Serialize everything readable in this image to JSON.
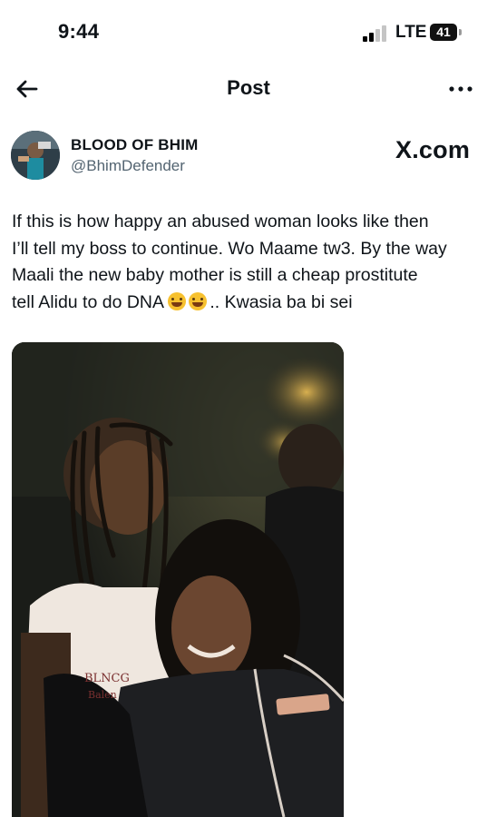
{
  "status_bar": {
    "time": "9:44",
    "network": "LTE",
    "battery": "41"
  },
  "nav": {
    "title": "Post",
    "back_icon": "arrow-left-icon",
    "more_icon": "more-horizontal-icon"
  },
  "author": {
    "name": "BLOOD OF BHIM",
    "handle": "@BhimDefender"
  },
  "source_logo": "X.com",
  "post": {
    "lines": [
      "If this is how happy an abused woman looks like then",
      "I’ll tell my boss to continue. Wo Maame tw3. By the way",
      "Maali the new baby mother is still a cheap prostitute",
      "tell Alidu to do DNA"
    ],
    "line4_suffix": ".. Kwasia ba bi sei",
    "emojis": [
      "rolling-on-floor-laughing-emoji",
      "face-with-tears-of-joy-emoji"
    ]
  },
  "media": {
    "shirt_text_1": "BLNCG",
    "shirt_text_2": "Balen"
  },
  "colors": {
    "text": "#0f1419",
    "secondary_text": "#536471",
    "background": "#ffffff"
  }
}
